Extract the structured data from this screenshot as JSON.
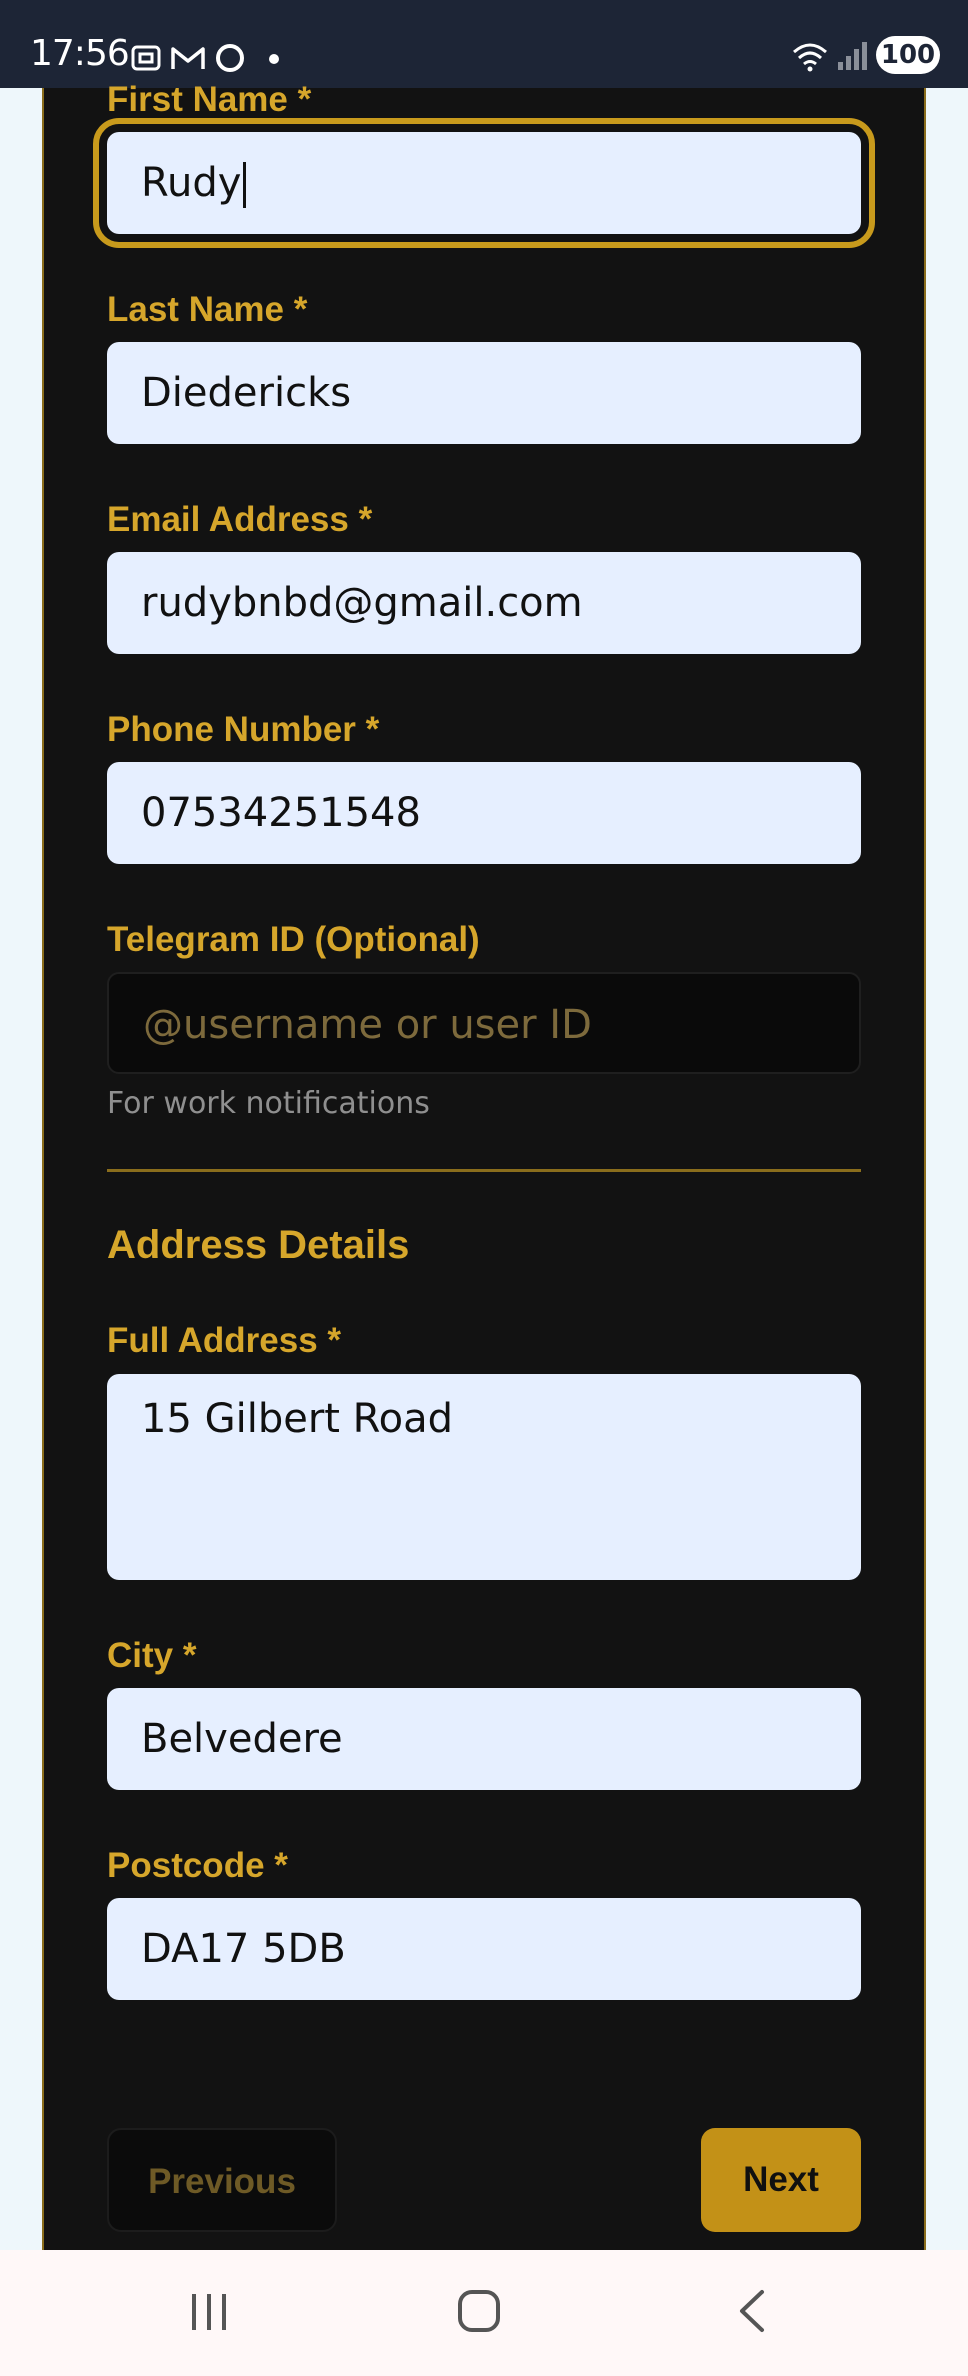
{
  "status": {
    "time": "17:56",
    "battery": "100",
    "icons": [
      "screenshot-icon",
      "gmail-icon",
      "circle-app-icon",
      "dot-icon",
      "wifi-icon",
      "signal-icon"
    ]
  },
  "form": {
    "first_name": {
      "label": "First Name *",
      "value": "Rudy"
    },
    "last_name": {
      "label": "Last Name *",
      "value": "Diedericks"
    },
    "email": {
      "label": "Email Address *",
      "value": "rudybnbd@gmail.com"
    },
    "phone": {
      "label": "Phone Number *",
      "value": "07534251548"
    },
    "telegram": {
      "label": "Telegram ID (Optional)",
      "placeholder": "@username or user ID",
      "hint": "For work notifications"
    },
    "address_section": "Address Details",
    "full_address": {
      "label": "Full Address *",
      "value": "15 Gilbert Road"
    },
    "city": {
      "label": "City *",
      "value": "Belvedere"
    },
    "postcode": {
      "label": "Postcode *",
      "value": "DA17 5DB"
    }
  },
  "buttons": {
    "previous": "Previous",
    "next": "Next"
  },
  "nav": {
    "icons": [
      "recent-apps-icon",
      "home-icon",
      "back-icon"
    ]
  },
  "colors": {
    "accent": "#d6a62b",
    "card": "#121212",
    "field": "#e6efff",
    "next_button": "#c39117"
  }
}
